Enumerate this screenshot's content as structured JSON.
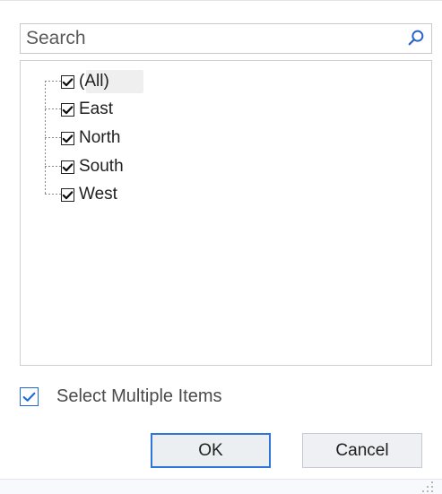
{
  "search": {
    "placeholder": "Search",
    "value": ""
  },
  "tree": {
    "items": [
      {
        "label": "(All)",
        "checked": true,
        "selected": true
      },
      {
        "label": "East",
        "checked": true,
        "selected": false
      },
      {
        "label": "North",
        "checked": true,
        "selected": false
      },
      {
        "label": "South",
        "checked": true,
        "selected": false
      },
      {
        "label": "West",
        "checked": true,
        "selected": false
      }
    ]
  },
  "options": {
    "select_multiple_label": "Select Multiple Items",
    "select_multiple_checked": true
  },
  "actions": {
    "ok_label": "OK",
    "cancel_label": "Cancel"
  },
  "colors": {
    "accent": "#2f74d8",
    "checkbox_blue": "#1f6ad8",
    "border": "#c9c9c9",
    "selection": "#efefef"
  },
  "icons": {
    "search": "search-icon",
    "checkbox": "check-icon",
    "resize": "resize-grip-icon"
  }
}
